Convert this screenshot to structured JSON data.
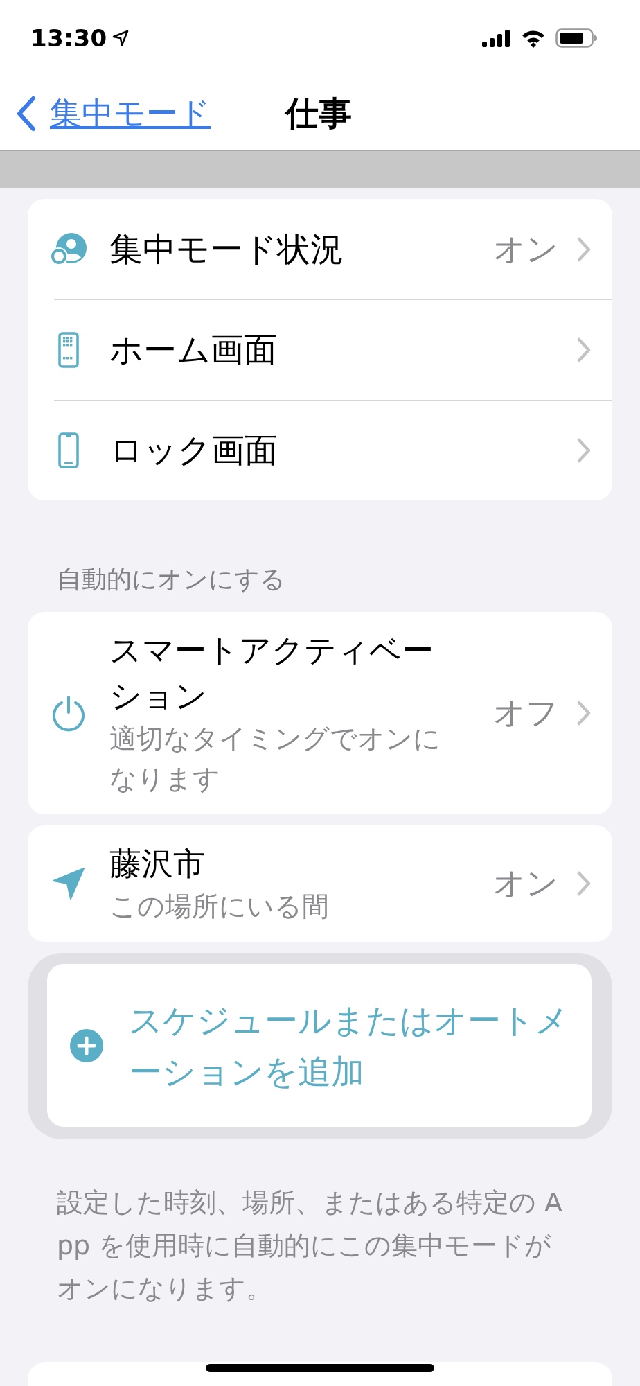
{
  "status_bar": {
    "time": "13:30"
  },
  "nav": {
    "back": "集中モード",
    "title": "仕事"
  },
  "settings": [
    {
      "kind": "status",
      "label": "集中モード状況",
      "value": "オン"
    },
    {
      "kind": "home",
      "label": "ホーム画面"
    },
    {
      "kind": "lock",
      "label": "ロック画面"
    }
  ],
  "auto_header": "自動的にオンにする",
  "automations": [
    {
      "kind": "power",
      "title": "スマートアクティベーション",
      "subtitle": "適切なタイミングでオンになります",
      "value": "オフ"
    },
    {
      "kind": "location",
      "title": "藤沢市",
      "subtitle": "この場所にいる間",
      "value": "オン"
    }
  ],
  "add_button": {
    "label": "スケジュールまたはオートメーションを追加",
    "highlighted": true
  },
  "footer": "設定した時刻、場所、またはある特定の App を使用時に自動的にこの集中モードがオンになります。"
}
